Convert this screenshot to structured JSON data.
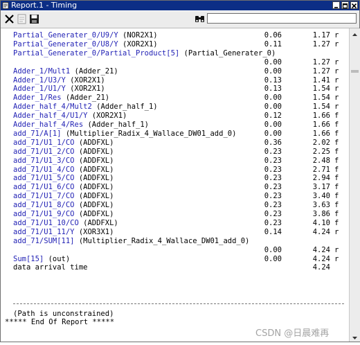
{
  "window": {
    "title": "Report.1 - Timing"
  },
  "toolbar": {
    "close_icon": "close-x-icon",
    "save_icon": "floppy-disk-icon",
    "find_icon": "binoculars-icon",
    "search_value": ""
  },
  "report": {
    "rows": [
      {
        "path": "Partial_Generater_0/U9/Y",
        "desc": " (NOR2X1)",
        "incr": "0.06",
        "total": "1.17",
        "edge": "r"
      },
      {
        "path": "Partial_Generater_0/U8/Y",
        "desc": " (XOR2X1)",
        "incr": "0.11",
        "total": "1.27",
        "edge": "r"
      },
      {
        "path": "Partial_Generater_0/Partial_Product[5]",
        "desc": " (Partial_Generater_0)",
        "incr": "",
        "total": "",
        "edge": ""
      },
      {
        "path": "",
        "desc": "",
        "incr": "0.00",
        "total": "1.27",
        "edge": "r"
      },
      {
        "path": "Adder_1/Mult1",
        "desc": " (Adder_21)",
        "incr": "0.00",
        "total": "1.27",
        "edge": "r"
      },
      {
        "path": "Adder_1/U3/Y",
        "desc": " (XOR2X1)",
        "incr": "0.13",
        "total": "1.41",
        "edge": "r"
      },
      {
        "path": "Adder_1/U1/Y",
        "desc": " (XOR2X1)",
        "incr": "0.13",
        "total": "1.54",
        "edge": "r"
      },
      {
        "path": "Adder_1/Res",
        "desc": " (Adder_21)",
        "incr": "0.00",
        "total": "1.54",
        "edge": "r"
      },
      {
        "path": "Adder_half_4/Mult2",
        "desc": " (Adder_half_1)",
        "incr": "0.00",
        "total": "1.54",
        "edge": "r"
      },
      {
        "path": "Adder_half_4/U1/Y",
        "desc": " (XOR2X1)",
        "incr": "0.12",
        "total": "1.66",
        "edge": "f"
      },
      {
        "path": "Adder_half_4/Res",
        "desc": " (Adder_half_1)",
        "incr": "0.00",
        "total": "1.66",
        "edge": "f"
      },
      {
        "path": "add_71/A[1]",
        "desc": " (Multiplier_Radix_4_Wallace_DW01_add_0)",
        "incr": "0.00",
        "total": "1.66",
        "edge": "f"
      },
      {
        "path": "add_71/U1_1/CO",
        "desc": " (ADDFXL)",
        "incr": "0.36",
        "total": "2.02",
        "edge": "f"
      },
      {
        "path": "add_71/U1_2/CO",
        "desc": " (ADDFXL)",
        "incr": "0.23",
        "total": "2.25",
        "edge": "f"
      },
      {
        "path": "add_71/U1_3/CO",
        "desc": " (ADDFXL)",
        "incr": "0.23",
        "total": "2.48",
        "edge": "f"
      },
      {
        "path": "add_71/U1_4/CO",
        "desc": " (ADDFXL)",
        "incr": "0.23",
        "total": "2.71",
        "edge": "f"
      },
      {
        "path": "add_71/U1_5/CO",
        "desc": " (ADDFXL)",
        "incr": "0.23",
        "total": "2.94",
        "edge": "f"
      },
      {
        "path": "add_71/U1_6/CO",
        "desc": " (ADDFXL)",
        "incr": "0.23",
        "total": "3.17",
        "edge": "f"
      },
      {
        "path": "add_71/U1_7/CO",
        "desc": " (ADDFXL)",
        "incr": "0.23",
        "total": "3.40",
        "edge": "f"
      },
      {
        "path": "add_71/U1_8/CO",
        "desc": " (ADDFXL)",
        "incr": "0.23",
        "total": "3.63",
        "edge": "f"
      },
      {
        "path": "add_71/U1_9/CO",
        "desc": " (ADDFXL)",
        "incr": "0.23",
        "total": "3.86",
        "edge": "f"
      },
      {
        "path": "add_71/U1_10/CO",
        "desc": " (ADDFXL)",
        "incr": "0.23",
        "total": "4.10",
        "edge": "f"
      },
      {
        "path": "add_71/U1_11/Y",
        "desc": " (XOR3X1)",
        "incr": "0.14",
        "total": "4.24",
        "edge": "r"
      },
      {
        "path": "add_71/SUM[11]",
        "desc": " (Multiplier_Radix_4_Wallace_DW01_add_0)",
        "incr": "",
        "total": "",
        "edge": ""
      },
      {
        "path": "",
        "desc": "",
        "incr": "0.00",
        "total": "4.24",
        "edge": "r"
      },
      {
        "path": "Sum[15]",
        "desc": " (out)",
        "incr": "0.00",
        "total": "4.24",
        "edge": "r"
      },
      {
        "path": "",
        "desc": "data arrival time",
        "incr": "",
        "total": "4.24",
        "edge": ""
      }
    ],
    "unconstrained_note": "(Path is unconstrained)",
    "end_line": "***** End Of Report *****"
  },
  "watermark": "CSDN @日晨难再"
}
